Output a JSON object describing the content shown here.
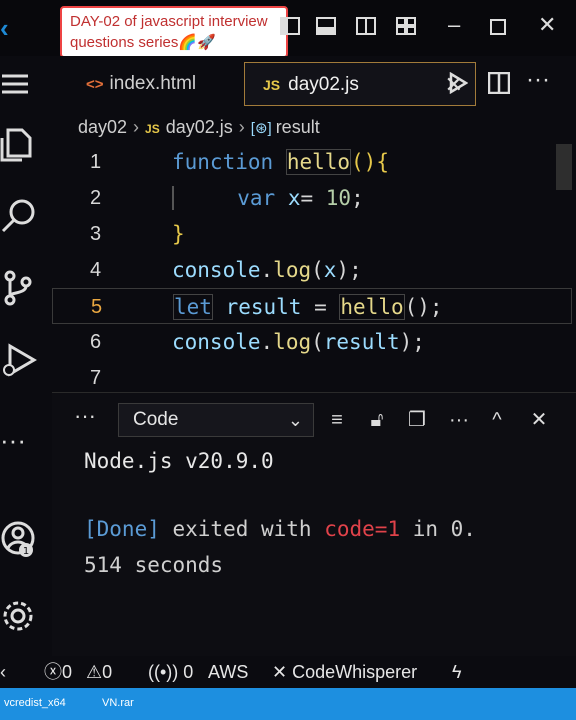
{
  "caption": {
    "line1": "DAY-02 of javascript interview",
    "line2": "questions series🌈🚀"
  },
  "tabs": [
    {
      "label": "index.html",
      "icon": "html-icon"
    },
    {
      "label": "day02.js",
      "icon": "js-icon",
      "active": true
    }
  ],
  "breadcrumb": {
    "folder": "day02",
    "file": "day02.js",
    "symbol": "result"
  },
  "editor": {
    "lines": [
      {
        "n": "1",
        "text": "function hello(){"
      },
      {
        "n": "2",
        "text": "    var x= 10;"
      },
      {
        "n": "3",
        "text": "}"
      },
      {
        "n": "4",
        "text": "console.log(x);"
      },
      {
        "n": "5",
        "text": "let result = hello();"
      },
      {
        "n": "6",
        "text": "console.log(result);"
      },
      {
        "n": "7",
        "text": ""
      }
    ],
    "active_line": "5"
  },
  "panel": {
    "more": "···",
    "output_select": "Code",
    "output": {
      "node_version": "Node.js v20.9.0",
      "done_tag": "[Done]",
      "exited_text": " exited with ",
      "code_text": "code=1",
      "in_text": " in 0.",
      "seconds_line": "514 seconds"
    }
  },
  "status": {
    "errors": "0",
    "warnings": "0",
    "ports": "0",
    "aws": "AWS",
    "codewhisperer": "CodeWhisperer"
  },
  "taskbar": {
    "item1": "vcredist_x64",
    "item2": "VN.rar"
  },
  "colors": {
    "accent": "#1e8ad6",
    "keyword": "#5b9bd5",
    "function": "#e5d88a",
    "error": "#e0424a",
    "taskbar": "#1d8fe0"
  }
}
